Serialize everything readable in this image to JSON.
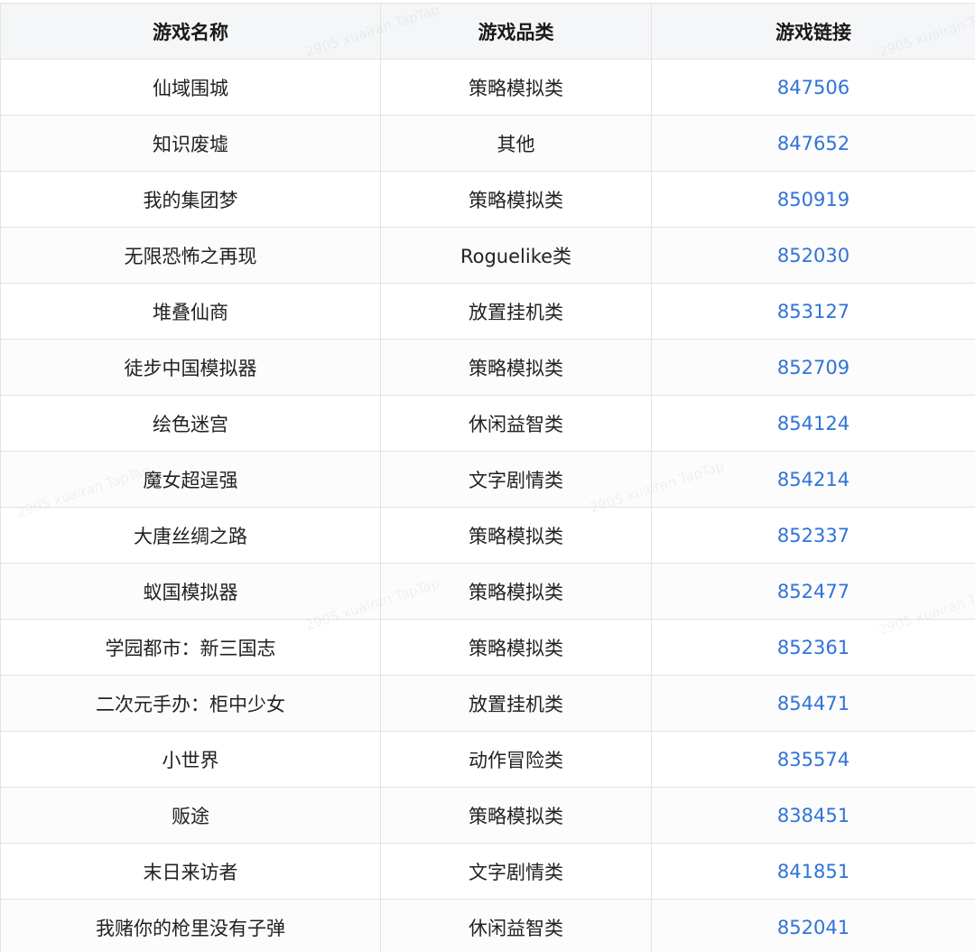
{
  "table": {
    "headers": [
      "游戏名称",
      "游戏品类",
      "游戏链接"
    ],
    "rows": [
      {
        "name": "仙域围城",
        "category": "策略模拟类",
        "link": "847506"
      },
      {
        "name": "知识废墟",
        "category": "其他",
        "link": "847652"
      },
      {
        "name": "我的集团梦",
        "category": "策略模拟类",
        "link": "850919"
      },
      {
        "name": "无限恐怖之再现",
        "category": "Roguelike类",
        "link": "852030"
      },
      {
        "name": "堆叠仙商",
        "category": "放置挂机类",
        "link": "853127"
      },
      {
        "name": "徒步中国模拟器",
        "category": "策略模拟类",
        "link": "852709"
      },
      {
        "name": "绘色迷宫",
        "category": "休闲益智类",
        "link": "854124"
      },
      {
        "name": "魔女超逞强",
        "category": "文字剧情类",
        "link": "854214"
      },
      {
        "name": "大唐丝绸之路",
        "category": "策略模拟类",
        "link": "852337"
      },
      {
        "name": "蚁国模拟器",
        "category": "策略模拟类",
        "link": "852477"
      },
      {
        "name": "学园都市：新三国志",
        "category": "策略模拟类",
        "link": "852361"
      },
      {
        "name": "二次元手办：柜中少女",
        "category": "放置挂机类",
        "link": "854471"
      },
      {
        "name": "小世界",
        "category": "动作冒险类",
        "link": "835574"
      },
      {
        "name": "贩途",
        "category": "策略模拟类",
        "link": "838451"
      },
      {
        "name": "末日来访者",
        "category": "文字剧情类",
        "link": "841851"
      },
      {
        "name": "我赌你的枪里没有子弹",
        "category": "休闲益智类",
        "link": "852041"
      }
    ]
  },
  "watermark": {
    "text": "2905 xuairan TapTap"
  },
  "colors": {
    "link": "#2f73d9",
    "header_bg": "#f5f6f8",
    "border": "#e3e3e3"
  }
}
